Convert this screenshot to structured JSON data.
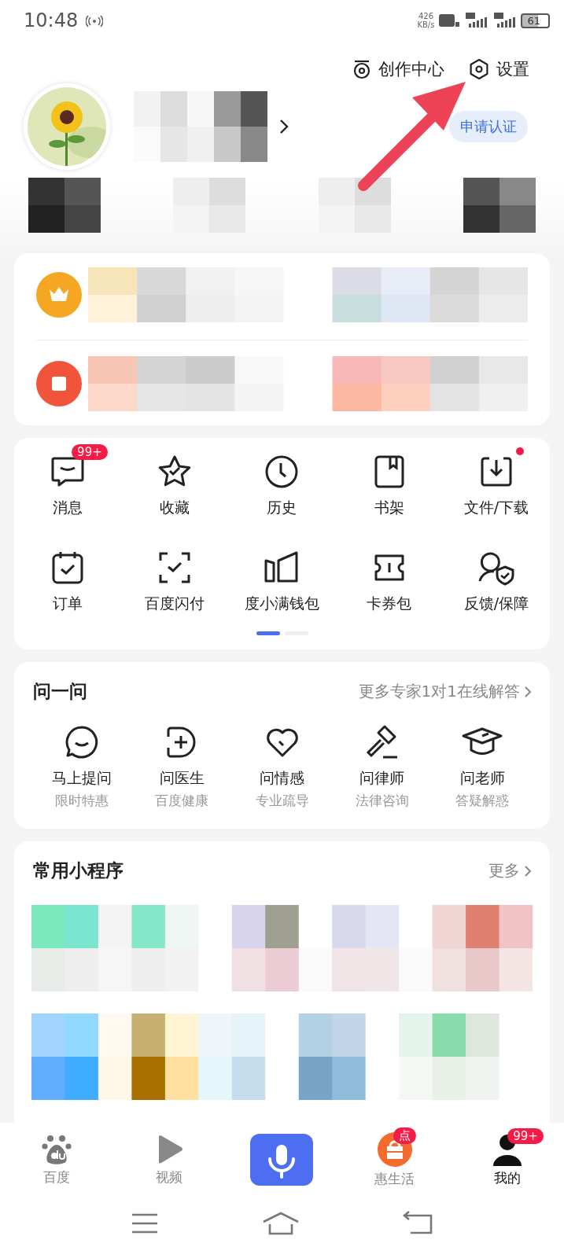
{
  "status_bar": {
    "time": "10:48",
    "speed": "426",
    "speed_unit": "KB/s",
    "battery": "61"
  },
  "top_links": [
    {
      "kind": "create",
      "label": "创作中心"
    },
    {
      "kind": "settings",
      "label": "设置"
    }
  ],
  "verify_button": "申请认证",
  "menu": {
    "items": [
      {
        "kind": "message",
        "label": "消息",
        "badge": "99+",
        "dot": false
      },
      {
        "kind": "star",
        "label": "收藏",
        "dot": false
      },
      {
        "kind": "clock",
        "label": "历史",
        "dot": false
      },
      {
        "kind": "book",
        "label": "书架",
        "dot": false
      },
      {
        "kind": "download",
        "label": "文件/下载",
        "dot": true
      },
      {
        "kind": "calendar",
        "label": "订单",
        "dot": false
      },
      {
        "kind": "scan",
        "label": "百度闪付",
        "dot": false
      },
      {
        "kind": "wallet",
        "label": "度小满钱包",
        "dot": false
      },
      {
        "kind": "ticket",
        "label": "卡券包",
        "dot": false
      },
      {
        "kind": "shield",
        "label": "反馈/保障",
        "dot": false
      }
    ],
    "pages": [
      {
        "selected": true
      },
      {
        "selected": false
      }
    ]
  },
  "ask": {
    "title": "问一问",
    "more": "更多专家1对1在线解答",
    "items": [
      {
        "kind": "chat",
        "label": "马上提问",
        "sub": "限时特惠"
      },
      {
        "kind": "doctor",
        "label": "问医生",
        "sub": "百度健康"
      },
      {
        "kind": "heart",
        "label": "问情感",
        "sub": "专业疏导"
      },
      {
        "kind": "gavel",
        "label": "问律师",
        "sub": "法律咨询"
      },
      {
        "kind": "cap",
        "label": "问老师",
        "sub": "答疑解惑"
      }
    ]
  },
  "mini_programs": {
    "title": "常用小程序",
    "more": "更多"
  },
  "tabs": [
    {
      "kind": "paw",
      "label": "百度",
      "selected": false
    },
    {
      "kind": "play",
      "label": "视频",
      "selected": false
    },
    {
      "kind": "mic"
    },
    {
      "kind": "bag",
      "label": "惠生活",
      "badge": "点",
      "selected": false
    },
    {
      "kind": "person",
      "label": "我的",
      "badge": "99+",
      "selected": true
    }
  ]
}
